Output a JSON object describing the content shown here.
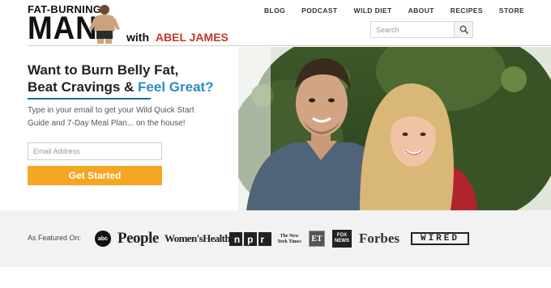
{
  "logo": {
    "top_text": "FAT-BURNING",
    "main_text": "MAN",
    "with_text": "with",
    "name_text": "ABEL JAMES"
  },
  "nav": {
    "items": [
      "BLOG",
      "PODCAST",
      "WILD DIET",
      "ABOUT",
      "RECIPES",
      "STORE"
    ]
  },
  "search": {
    "placeholder": "Search"
  },
  "hero": {
    "headline_line1": "Want to Burn Belly Fat,",
    "headline_line2_a": "Beat Cravings & ",
    "headline_line2_b": "Feel Great?",
    "subtext": "Type in your email to get your Wild Quick Start Guide and 7-Day Meal Plan... on the house!",
    "email_placeholder": "Email Address",
    "cta_label": "Get Started"
  },
  "featured": {
    "label": "As Featured On:",
    "logos": {
      "abc": "abc",
      "people": "People",
      "womenshealth": "Women'sHealth",
      "npr": "npr",
      "nyt": "The New York Times",
      "et": "ET",
      "fox": "FOX NEWS",
      "forbes": "Forbes",
      "wired": "WIRED"
    }
  },
  "colors": {
    "accent_blue": "#2a8dc4",
    "cta_orange": "#f5a623",
    "brand_red": "#c0392b"
  }
}
